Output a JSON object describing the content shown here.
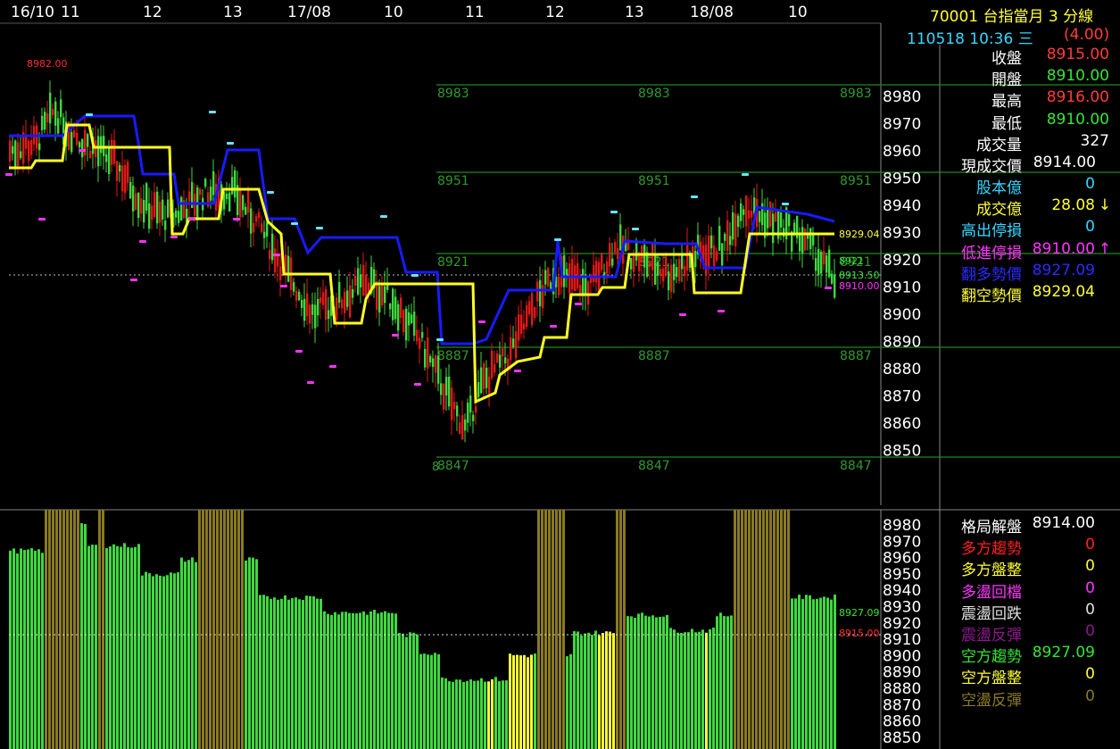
{
  "header": {
    "symbol_title": "70001  台指當月 3 分線",
    "datetime": "110518 10:36 三",
    "change": "(4.00)"
  },
  "time_axis": [
    "16/10",
    "11",
    "12",
    "13",
    "17/08",
    "10",
    "11",
    "12",
    "13",
    "18/08",
    "10"
  ],
  "price_axis_top": [
    "8980",
    "8970",
    "8960",
    "8950",
    "8940",
    "8930",
    "8920",
    "8910",
    "8900",
    "8890",
    "8880",
    "8870",
    "8860",
    "8850"
  ],
  "price_axis_bottom": [
    "8980",
    "8970",
    "8960",
    "8950",
    "8940",
    "8930",
    "8920",
    "8910",
    "8900",
    "8890",
    "8880",
    "8870",
    "8860",
    "8850"
  ],
  "level_labels": {
    "r1": "8983",
    "r2": "8951",
    "r3": "8921",
    "r4": "8887",
    "r5": "8847",
    "r5_prefix": "8",
    "peak": "8982.00",
    "yellow_tag": "8929.04",
    "mid_tag": "8913.50",
    "low_tag": "8910.00",
    "bottom_green_tag": "8927.09",
    "bottom_red_tag": "8915.00"
  },
  "quote_panel": [
    {
      "label": "收盤",
      "value": "8915.00",
      "label_color": "#ffffff",
      "value_color": "#ff3b3b"
    },
    {
      "label": "開盤",
      "value": "8910.00",
      "label_color": "#ffffff",
      "value_color": "#35e635"
    },
    {
      "label": "最高",
      "value": "8916.00",
      "label_color": "#ffffff",
      "value_color": "#ff3b3b"
    },
    {
      "label": "最低",
      "value": "8910.00",
      "label_color": "#ffffff",
      "value_color": "#35e635"
    },
    {
      "label": "成交量",
      "value": "327",
      "label_color": "#ffffff",
      "value_color": "#ffffff"
    },
    {
      "label": "現成交價",
      "value": "8914.00",
      "label_color": "#ffffff",
      "value_color": "#ffffff"
    },
    {
      "label": "股本億",
      "value": "0",
      "label_color": "#35d7ff",
      "value_color": "#35d7ff"
    },
    {
      "label": "成交億",
      "value": "28.08",
      "label_color": "#ffff33",
      "value_color": "#ffff33",
      "arrow": "↓",
      "arrow_color": "#ffff33"
    },
    {
      "label": "高出停損",
      "value": "0",
      "label_color": "#35d7ff",
      "value_color": "#35d7ff"
    },
    {
      "label": "低進停損",
      "value": "8910.00",
      "label_color": "#ff33ff",
      "value_color": "#ff33ff",
      "arrow": "↑",
      "arrow_color": "#ff33ff"
    },
    {
      "label": "翻多勢價",
      "value": "8927.09",
      "label_color": "#2a2aff",
      "value_color": "#2a2aff"
    },
    {
      "label": "翻空勢價",
      "value": "8929.04",
      "label_color": "#ffff33",
      "value_color": "#ffff33"
    }
  ],
  "trend_panel": [
    {
      "label": "格局解盤",
      "value": "8914.00",
      "label_color": "#ffffff",
      "value_color": "#ffffff"
    },
    {
      "label": "多方趨勢",
      "value": "0",
      "label_color": "#ff2020",
      "value_color": "#ff2020"
    },
    {
      "label": "多方盤整",
      "value": "0",
      "label_color": "#ffff33",
      "value_color": "#ffff33"
    },
    {
      "label": "多盪回檔",
      "value": "0",
      "label_color": "#ff33ff",
      "value_color": "#ff33ff"
    },
    {
      "label": "震盪回跌",
      "value": "0",
      "label_color": "#e0e0e0",
      "value_color": "#e0e0e0"
    },
    {
      "label": "震盪反彈",
      "value": "0",
      "label_color": "#8a1a8a",
      "value_color": "#8a1a8a"
    },
    {
      "label": "空方趨勢",
      "value": "8927.09",
      "label_color": "#35e635",
      "value_color": "#35e635"
    },
    {
      "label": "空方盤整",
      "value": "0",
      "label_color": "#ffff33",
      "value_color": "#ffff33"
    },
    {
      "label": "空盪反彈",
      "value": "0",
      "label_color": "#8a7a20",
      "value_color": "#8a7a20"
    }
  ],
  "colors": {
    "up": "#e01818",
    "down": "#3fd83f",
    "blue_line": "#1a1aff",
    "yellow_line": "#ffff22",
    "level_line": "#1f8a1f",
    "cyan_marker": "#66e6ff",
    "magenta_marker": "#ff33ff",
    "olive_bar": "#8a7a20"
  }
}
